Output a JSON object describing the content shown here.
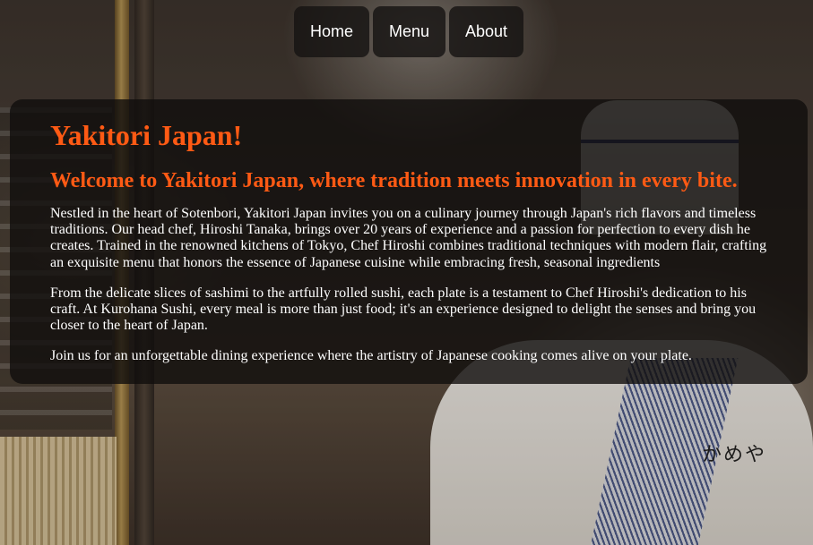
{
  "nav": {
    "items": [
      {
        "label": "Home"
      },
      {
        "label": "Menu"
      },
      {
        "label": "About"
      }
    ]
  },
  "main": {
    "title": "Yakitori Japan!",
    "subtitle": "Welcome to Yakitori Japan, where tradition meets innovation in every bite.",
    "paragraphs": [
      "Nestled in the heart of Sotenbori, Yakitori Japan invites you on a culinary journey through Japan's rich flavors and timeless traditions. Our head chef, Hiroshi Tanaka, brings over 20 years of experience and a passion for perfection to every dish he creates. Trained in the renowned kitchens of Tokyo, Chef Hiroshi combines traditional techniques with modern flair, crafting an exquisite menu that honors the essence of Japanese cuisine while embracing fresh, seasonal ingredients",
      "From the delicate slices of sashimi to the artfully rolled sushi, each plate is a testament to Chef Hiroshi's dedication to his craft. At Kurohana Sushi, every meal is more than just food; it's an experience designed to delight the senses and bring you closer to the heart of Japan.",
      "Join us for an unforgettable dining experience where the artistry of Japanese cooking comes alive on your plate."
    ]
  },
  "background": {
    "signage_text": "かめや"
  },
  "colors": {
    "accent": "#ff5a14",
    "card_bg": "#100e0d",
    "text": "#ffffff"
  }
}
